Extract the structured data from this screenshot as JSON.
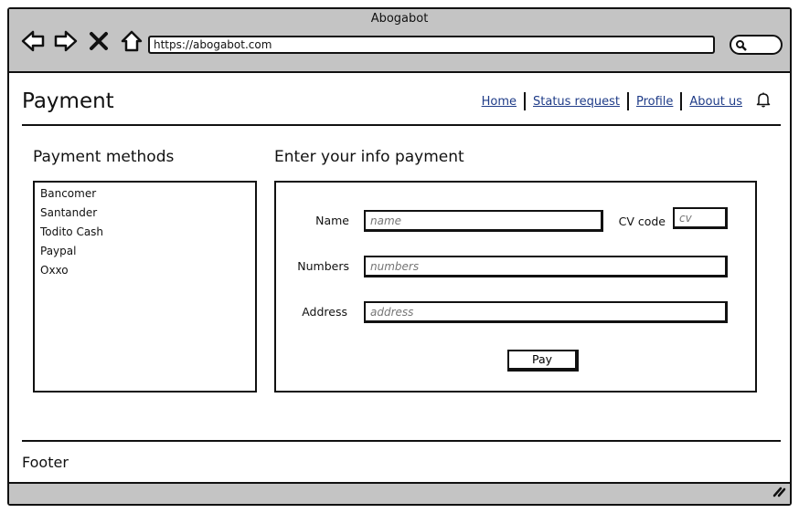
{
  "window": {
    "title": "Abogabot"
  },
  "browser": {
    "url": "https://abogabot.com",
    "icons": [
      "back-icon",
      "forward-icon",
      "close-icon",
      "home-icon",
      "search-icon"
    ]
  },
  "header": {
    "title": "Payment",
    "nav": [
      {
        "label": "Home"
      },
      {
        "label": "Status request"
      },
      {
        "label": "Profile"
      },
      {
        "label": "About us"
      }
    ],
    "bell_icon": "bell-icon"
  },
  "payment_methods": {
    "label": "Payment methods",
    "items": [
      "Bancomer",
      "Santander",
      "Todito Cash",
      "Paypal",
      "Oxxo"
    ]
  },
  "form": {
    "label": "Enter your info payment",
    "name_label": "Name",
    "name_placeholder": "name",
    "cv_label": "CV code",
    "cv_placeholder": "cv",
    "numbers_label": "Numbers",
    "numbers_placeholder": "numbers",
    "address_label": "Address",
    "address_placeholder": "address",
    "pay_label": "Pay"
  },
  "footer": {
    "label": "Footer"
  },
  "colors": {
    "chrome": "#c4c4c4",
    "link": "#1f3c88",
    "placeholder": "#999999"
  }
}
